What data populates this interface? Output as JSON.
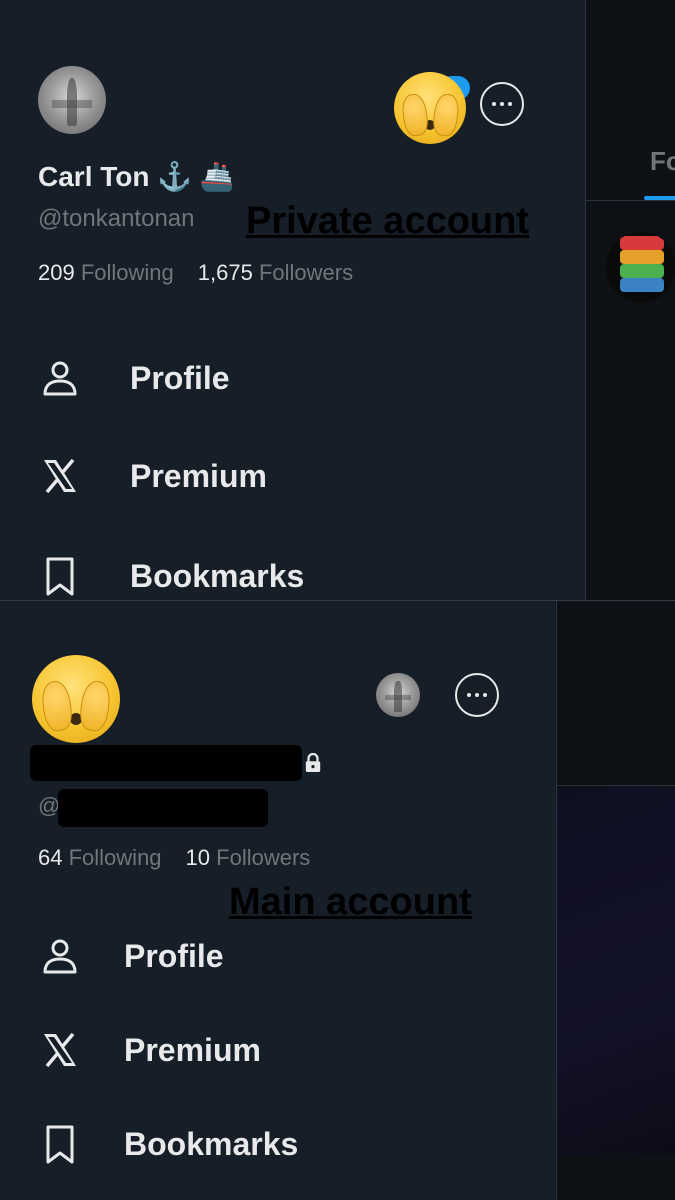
{
  "top": {
    "annotation": "Private account",
    "name": "Carl Ton",
    "name_emoji": "⚓️ 🚢",
    "handle": "@tonkantonan",
    "following_count": "209",
    "following_label": "Following",
    "followers_count": "1,675",
    "followers_label": "Followers",
    "menu": [
      {
        "label": "Profile",
        "icon": "person-icon"
      },
      {
        "label": "Premium",
        "icon": "x-logo-icon"
      },
      {
        "label": "Bookmarks",
        "icon": "bookmark-icon"
      }
    ],
    "side_tab_partial": "Fo"
  },
  "bottom": {
    "annotation": "Main account",
    "handle_prefix": "@",
    "following_count": "64",
    "following_label": "Following",
    "followers_count": "10",
    "followers_label": "Followers",
    "menu": [
      {
        "label": "Profile",
        "icon": "person-icon"
      },
      {
        "label": "Premium",
        "icon": "x-logo-icon"
      },
      {
        "label": "Bookmarks",
        "icon": "bookmark-icon"
      }
    ]
  },
  "colors": {
    "drawer_bg": "#161e28",
    "text_primary": "#e7e9ea",
    "text_secondary": "#71767b",
    "accent_blue": "#1d9bf0"
  }
}
